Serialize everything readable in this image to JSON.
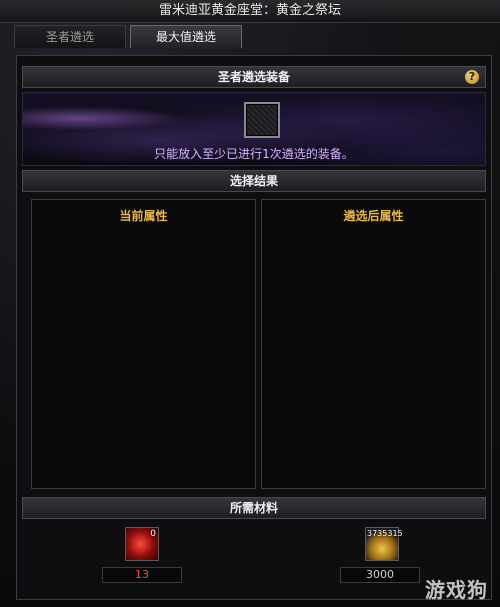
{
  "window": {
    "title": "雷米迪亚黄金座堂：黄金之祭坛"
  },
  "tabs": [
    {
      "label": "圣者遴选",
      "active": false
    },
    {
      "label": "最大值遴选",
      "active": true
    }
  ],
  "equipment_section": {
    "header": "圣者遴选装备",
    "help_label": "?",
    "hint": "只能放入至少已进行1次遴选的装备。"
  },
  "result_section": {
    "header": "选择结果",
    "current_label": "当前属性",
    "after_label": "遴选后属性"
  },
  "materials_section": {
    "header": "所需材料",
    "items": [
      {
        "icon": "red-gem-icon",
        "badge": "0",
        "count": "13",
        "count_color": "#e05a3a"
      },
      {
        "icon": "gold-coin-icon",
        "badge": "3735315",
        "count": "3000",
        "count_color": "#d0d0d0"
      }
    ]
  },
  "watermark": "游戏狗"
}
